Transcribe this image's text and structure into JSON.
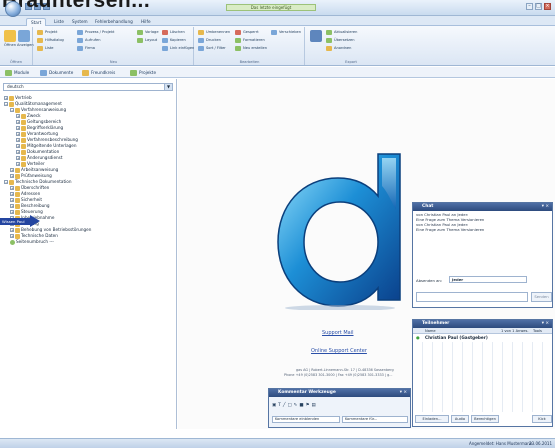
{
  "page_heading": "Brauntersen...",
  "window": {
    "title": "Das letzte eingefügt"
  },
  "menu_tabs": [
    "Start",
    "Liste",
    "System",
    "Fehlerbehandlung",
    "Hilfe"
  ],
  "ribbon": {
    "groups": [
      "Öffnen",
      "Neu",
      "Bearbeiten",
      "Export"
    ],
    "big_buttons": [
      "Öffnen",
      "Anzeigen"
    ],
    "items": [
      "Projekt",
      "Prozess / Projekt",
      "Vorlage",
      "Löschen",
      "Umbenennen",
      "Gesperrt",
      "Verschieben",
      "Hilfsdialog",
      "Aufrufen",
      "Layout",
      "Kopieren",
      "Drucken",
      "Formatieren",
      "Liste",
      "Firma",
      "Link einfügen",
      "Sort / Filter",
      "Neu erstellen",
      "Aktualisieren",
      "Übersetzen",
      "Anordnen"
    ]
  },
  "subtabs": [
    "Module",
    "Dokumente",
    "Freundkreis",
    "Projekte"
  ],
  "language_select": "deutsch",
  "tree": [
    "Vertrieb",
    "Qualitätsmanagement",
    "Verfahrensanweisung",
    "Zweck",
    "Geltungsbereich",
    "Begriffserklärung",
    "Verantwortung",
    "Verfahrensbeschreibung",
    "Mitgeltende Unterlagen",
    "Dokumentation",
    "Änderungsdienst",
    "Verteiler",
    "Arbeitsanweisung",
    "Prüfanweisung",
    "Technische Dokumentation",
    "Überschriften",
    "Adressen",
    "Sicherheit",
    "Beschreibung",
    "Steuerung",
    "Inbetriebnahme",
    "Wartung",
    "Behebung von Betriebsstörungen",
    "Technische Daten",
    "Seitenumbruch ---"
  ],
  "highlight_label": "Wissen Paul",
  "main": {
    "support_mail": "Support Mail",
    "online_support": "Online Support Center",
    "footer_line1": "gas AG | Robert-Linnemann-Str. 17 | D-48336 Sassenberg",
    "footer_line2": "Phone +49 (0)2583 301-3000 | Fax +49 (0)2583 301-3333 | g..."
  },
  "chat": {
    "title": "Chat",
    "messages": [
      "von Christian Paul an Jeder:",
      "Eine Frage zum Thema Versionieren",
      "von Christian Paul an Jeder:",
      "Eine Frage zum Thema Versionieren"
    ],
    "recipient_label": "Absenden an:",
    "recipient_value": "Jeder",
    "send_label": "Senden"
  },
  "participants": {
    "title": "Teilnehmer",
    "columns": [
      "Name",
      "1 von 1 Anwes.",
      "Tools"
    ],
    "rows": [
      {
        "name": "Christian Paul (Gastgeber)"
      }
    ],
    "buttons": [
      "Einladen...",
      "Audio",
      "Berechtigen",
      "Kick"
    ]
  },
  "comment_toolbar": {
    "title": "Kommentar Werkzeuge",
    "field1": "Kommentare einblenden",
    "field2": "Kommentare für..."
  },
  "status": {
    "user": "Angemeldet: Hans Mustermann",
    "date": "23.06.2011"
  },
  "colors": {
    "accent": "#2d4b7e",
    "highlight": "#2445a0",
    "ribbon": "#dbe6f4"
  }
}
